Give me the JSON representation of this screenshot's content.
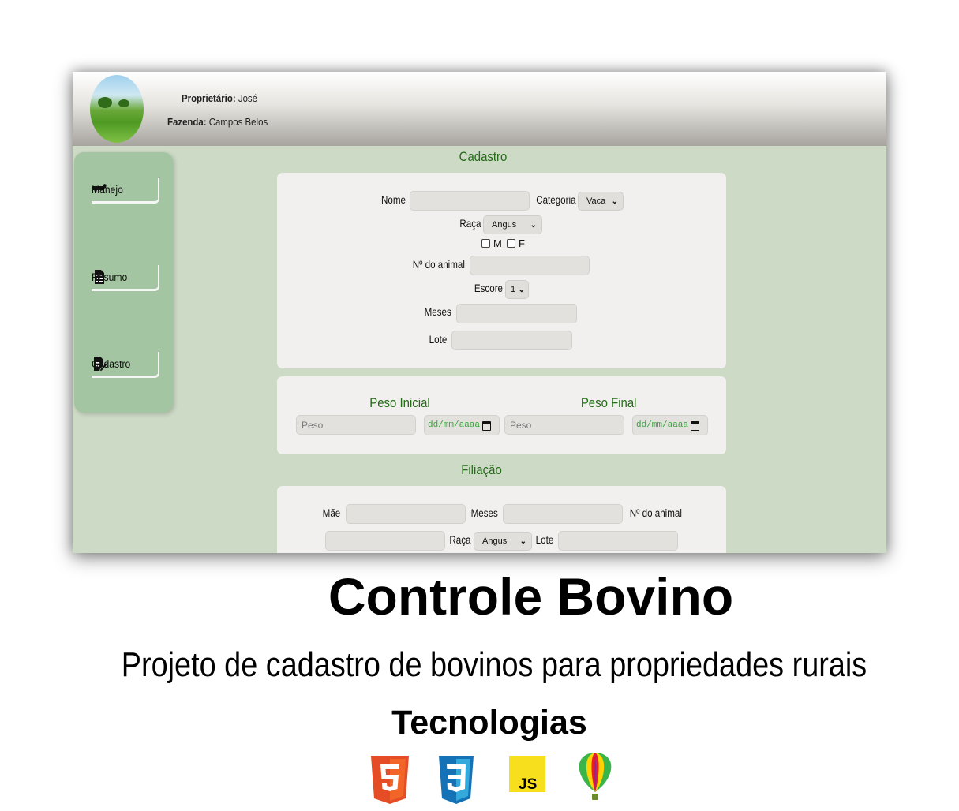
{
  "header": {
    "owner_label": "Proprietário:",
    "owner_value": "José",
    "farm_label": "Fazenda:",
    "farm_value": "Campos Belos"
  },
  "sidebar": {
    "items": [
      {
        "label": "Manejo",
        "icon": "cow-icon"
      },
      {
        "label": "Resumo",
        "icon": "document-list-icon"
      },
      {
        "label": "Cadastro",
        "icon": "document-edit-icon"
      }
    ]
  },
  "cadastro": {
    "title": "Cadastro",
    "nome_label": "Nome",
    "categoria_label": "Categoria",
    "categoria_value": "Vaca",
    "raca_label": "Raça",
    "raca_value": "Angus",
    "sex_m": "M",
    "sex_f": "F",
    "numero_label": "Nº do animal",
    "escore_label": "Escore",
    "escore_value": "1",
    "meses_label": "Meses",
    "lote_label": "Lote"
  },
  "peso": {
    "inicial_title": "Peso Inicial",
    "final_title": "Peso Final",
    "peso_placeholder": "Peso",
    "date_placeholder": "dd/mm/aaaa"
  },
  "filiacao": {
    "title": "Filiação",
    "mae_label": "Mãe",
    "meses_label": "Meses",
    "numero_label": "Nº do animal",
    "raca_label": "Raça",
    "raca_value": "Angus",
    "lote_label": "Lote"
  },
  "footer": {
    "title": "Controle Bovino",
    "subtitle": "Projeto de cadastro de bovinos para propriedades rurais",
    "tech_title": "Tecnologias",
    "tech_icons": [
      "html5-icon",
      "css3-icon",
      "javascript-icon",
      "coreldraw-icon"
    ],
    "js_label": "JS"
  },
  "colors": {
    "page_bg": "#cddac6",
    "sidebar_bg": "#a4c5a2",
    "accent_green": "#246b18",
    "card_bg": "#f2f0ee",
    "html5": "#e44d26",
    "css3": "#1572b6",
    "js": "#f7df1e"
  }
}
